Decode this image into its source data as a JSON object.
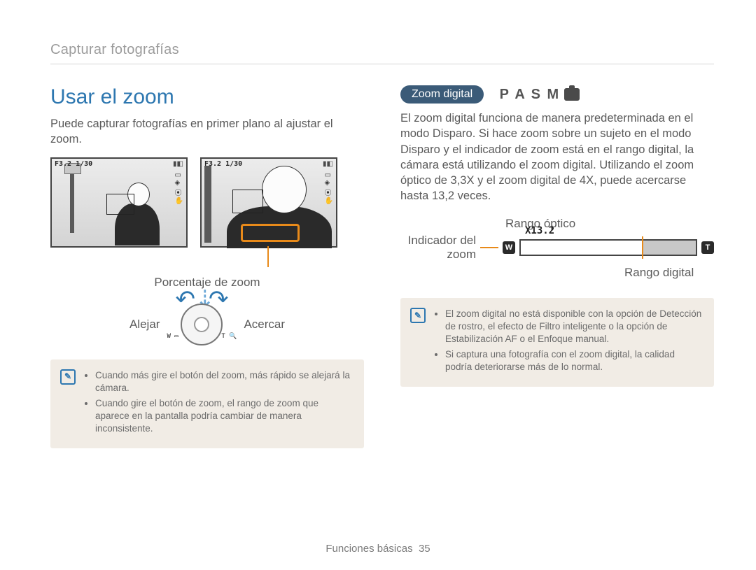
{
  "breadcrumb": "Capturar fotografías",
  "heading": "Usar el zoom",
  "intro": "Puede capturar fotografías en primer plano al ajustar el zoom.",
  "shot_overlay": "F3.2 1/30",
  "zoom_percent_label": "Porcentaje de zoom",
  "dial": {
    "left": "Alejar",
    "right": "Acercar",
    "w": "W",
    "t": "T"
  },
  "note1": [
    "Cuando más gire el botón del zoom, más rápido se alejará la cámara.",
    "Cuando gire el botón de zoom, el rango de zoom que aparece en la pantalla podría cambiar de manera inconsistente."
  ],
  "right": {
    "pill": "Zoom digital",
    "modes": "P A S M",
    "para": "El zoom digital funciona de manera predeterminada en el modo Disparo. Si hace zoom sobre un sujeto en el modo Disparo y el indicador de zoom está en el rango digital, la cámara está utilizando el zoom digital. Utilizando el zoom óptico de 3,3X y el zoom digital de 4X, puede acercarse hasta 13,2 veces.",
    "rd_top": "Rango óptico",
    "rd_left": "Indicador del zoom",
    "rd_value": "X13.2",
    "rd_w": "W",
    "rd_t": "T",
    "rd_bottom": "Rango digital",
    "note2": [
      "El zoom digital no está disponible con la opción de Detección de rostro, el efecto de Filtro inteligente o la opción de Estabilización AF o el Enfoque manual.",
      "Si captura una fotografía con el zoom digital, la calidad podría deteriorarse más de lo normal."
    ]
  },
  "footer": {
    "section": "Funciones básicas",
    "page": "35"
  }
}
